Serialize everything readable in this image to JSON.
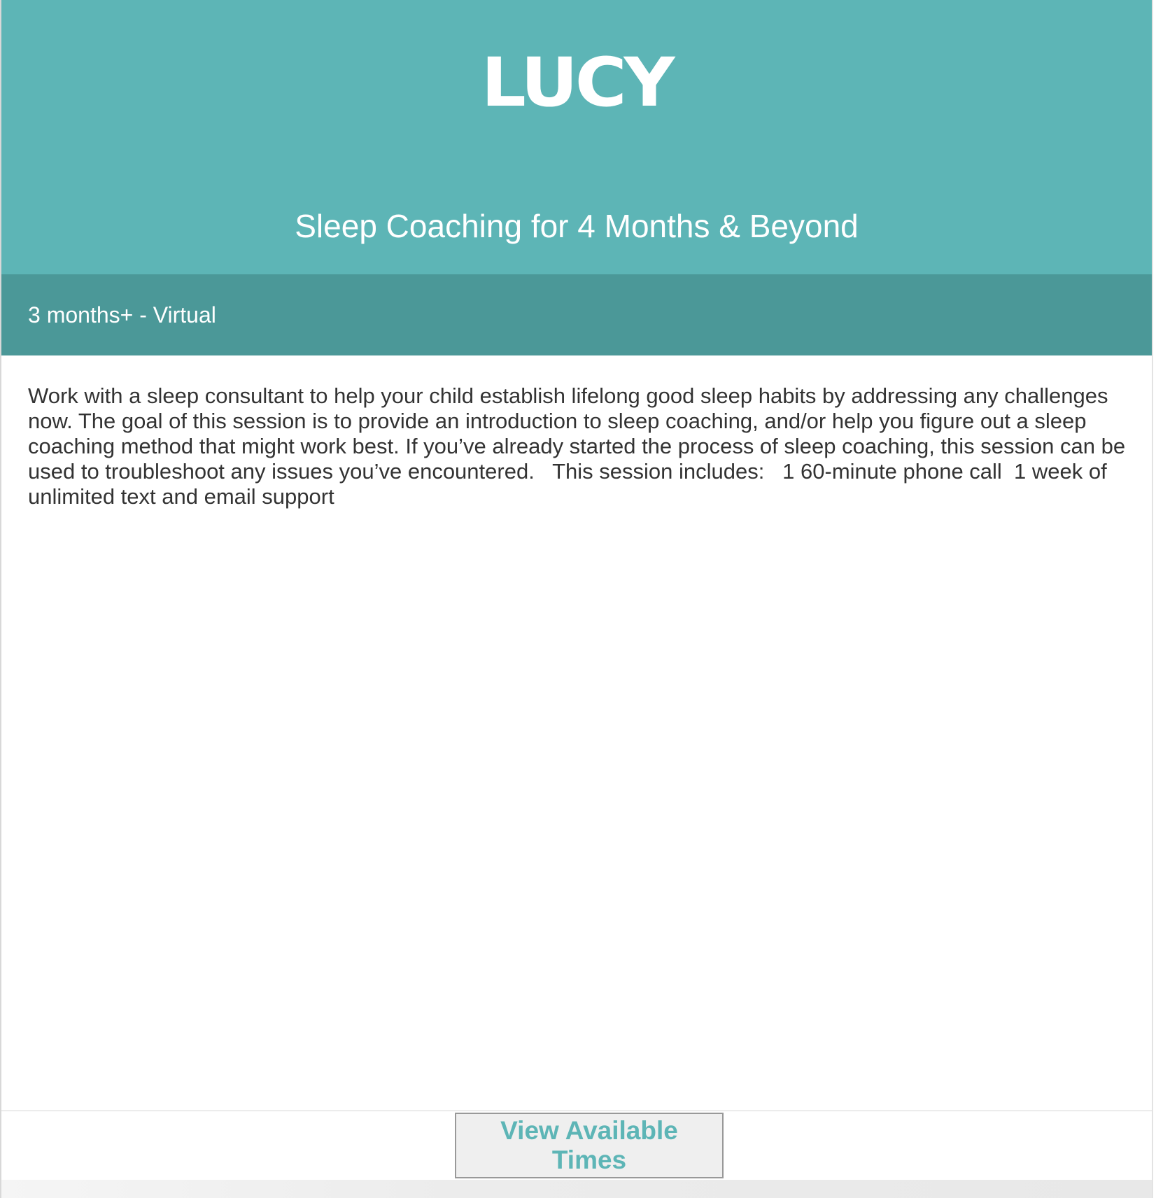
{
  "header": {
    "logo_text": "LUCY",
    "title": "Sleep Coaching for 4 Months & Beyond",
    "background_color": "#5db5b6"
  },
  "subheader": {
    "text": "3 months+ - Virtual",
    "background_color": "#4b9898"
  },
  "description": {
    "text": "Work with a sleep consultant to help your child establish lifelong good sleep habits by addressing any challenges now. The goal of this session is to provide an introduction to sleep coaching, and/or help you figure out a sleep coaching method that might work best. If you’ve already started the process of sleep coaching, this session can be used to troubleshoot any issues you’ve encountered.   This session includes:   1 60-minute phone call  1 week of unlimited text and email support"
  },
  "actions": {
    "view_times_label": "View Available Times",
    "accent_color": "#5db5b6"
  }
}
